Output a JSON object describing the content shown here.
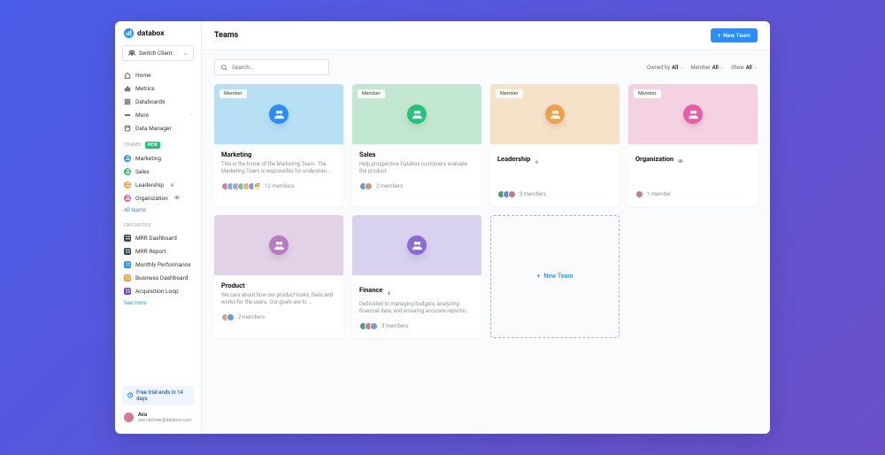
{
  "brand": "databox",
  "switch_client": "Switch Client",
  "nav": [
    {
      "label": "Home"
    },
    {
      "label": "Metrics"
    },
    {
      "label": "Databoards"
    },
    {
      "label": "More",
      "expandable": true
    },
    {
      "label": "Data Manager"
    }
  ],
  "teams_header": "TEAMS",
  "teams_badge": "New",
  "sidebar_teams": [
    {
      "label": "Marketing",
      "color": "#2a8cff"
    },
    {
      "label": "Sales",
      "color": "#27c27a"
    },
    {
      "label": "Leadership",
      "color": "#f0a04b",
      "locked": true
    },
    {
      "label": "Organization",
      "color": "#e85da8",
      "watched": true
    }
  ],
  "all_teams": "All teams",
  "favorites_header": "FAVORITES",
  "favorites": [
    {
      "label": "MRR Dashboard",
      "color": "#3a4756"
    },
    {
      "label": "MRR Report",
      "color": "#3a4756"
    },
    {
      "label": "Monthly Performance",
      "color": "#2a8cff"
    },
    {
      "label": "Business Dashboard",
      "color": "#f0a04b"
    },
    {
      "label": "Acquisition Loop",
      "color": "#6b4fc9"
    }
  ],
  "see_more": "See more",
  "trial": "Free trial ends in 14 days",
  "user": {
    "name": "Ava",
    "email": "ava.cechner@databox.com"
  },
  "page_title": "Teams",
  "new_team_btn": "New Team",
  "search_placeholder": "Search...",
  "filters": [
    {
      "label": "Owned by",
      "value": "All"
    },
    {
      "label": "Member",
      "value": "All"
    },
    {
      "label": "Show",
      "value": "All"
    }
  ],
  "cards": [
    {
      "title": "Marketing",
      "badge": "Member",
      "hero_bg": "#b8e0f5",
      "circle": "#2a8cff",
      "desc": "This is the home of the Marketing Team. The Marketing Team is responsible for understan...",
      "members_text": "12 members",
      "avatars": [
        "#d37a9a",
        "#6bb8e8",
        "#b89ad3",
        "#7ac29a",
        "#f0b06b",
        "#8a9ad3",
        "#e88a8a"
      ],
      "more": "+7"
    },
    {
      "title": "Sales",
      "badge": "Member",
      "hero_bg": "#c2e8d2",
      "circle": "#27c27a",
      "desc": "Help prospective Databox customers evaluate the product.",
      "members_text": "2 members",
      "avatars": [
        "#6b9ad3",
        "#c29a7a"
      ]
    },
    {
      "title": "Leadership",
      "badge": "Member",
      "locked": true,
      "hero_bg": "#f5e2c8",
      "circle": "#f0a04b",
      "desc": "",
      "members_text": "3 members",
      "avatars": [
        "#4a9a8a",
        "#6b8ad3",
        "#c27a9a"
      ]
    },
    {
      "title": "Organization",
      "badge": "Member",
      "watched": true,
      "hero_bg": "#f5d2e2",
      "circle": "#e85da8",
      "desc": "",
      "members_text": "1 member",
      "avatars": [
        "#c27a9a"
      ]
    },
    {
      "title": "Product",
      "hero_bg": "#e2d2e8",
      "circle": "#b87ac2",
      "desc": "We care about how our product looks, feels and works for the users. Our goals are to …",
      "members_text": "2 members",
      "avatars": [
        "#d3a87a",
        "#6b9ad3"
      ]
    },
    {
      "title": "Finance",
      "locked": true,
      "hero_bg": "#d8d2f0",
      "circle": "#8a6bd3",
      "desc": "Dedicated to managing budgets, analyzing financial data, and ensuring accurate reportin...",
      "members_text": "3 members",
      "avatars": [
        "#4a9a8a",
        "#c27a9a",
        "#7a9ac2"
      ]
    }
  ],
  "placeholder_label": "New Team"
}
